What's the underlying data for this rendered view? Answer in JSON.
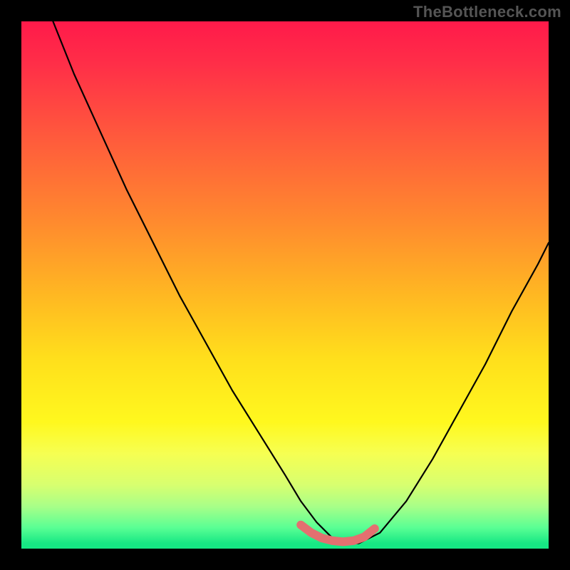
{
  "watermark": "TheBottleneck.com",
  "chart_data": {
    "type": "line",
    "title": "",
    "xlabel": "",
    "ylabel": "",
    "xlim": [
      0,
      100
    ],
    "ylim": [
      0,
      100
    ],
    "series": [
      {
        "name": "bottleneck-curve",
        "color": "#000000",
        "x": [
          6,
          10,
          15,
          20,
          25,
          30,
          35,
          40,
          45,
          50,
          53,
          56,
          59,
          62,
          64,
          68,
          73,
          78,
          83,
          88,
          93,
          98,
          100
        ],
        "values": [
          100,
          90,
          79,
          68,
          58,
          48,
          39,
          30,
          22,
          14,
          9,
          5,
          2,
          1,
          1,
          3,
          9,
          17,
          26,
          35,
          45,
          54,
          58
        ]
      },
      {
        "name": "green-marker",
        "color": "#e37070",
        "x": [
          53,
          55,
          57,
          59,
          61,
          63,
          65,
          67
        ],
        "values": [
          4.5,
          3,
          2,
          1.5,
          1.3,
          1.5,
          2.2,
          3.8
        ]
      }
    ]
  }
}
